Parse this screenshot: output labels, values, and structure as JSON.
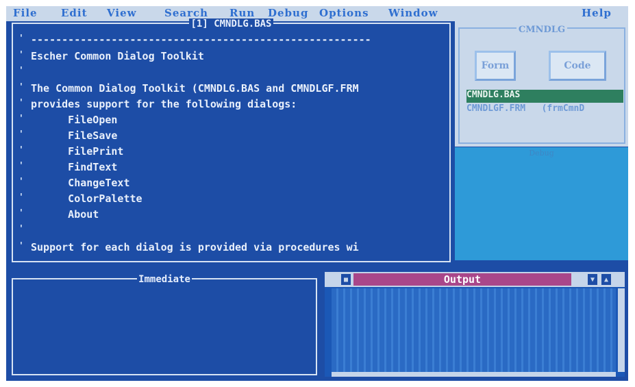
{
  "menu": {
    "items": [
      "File",
      "Edit",
      "View",
      "Search",
      "Run",
      "Debug",
      "Options",
      "Window"
    ],
    "help": "Help"
  },
  "editor": {
    "title": "[1] CMNDLG.BAS",
    "lines": [
      "-------------------------------------------------------",
      "Escher Common Dialog Toolkit",
      "",
      "The Common Dialog Toolkit (CMNDLG.BAS and CMNDLGF.FRM",
      "provides support for the following dialogs:",
      "      FileOpen",
      "      FileSave",
      "      FilePrint",
      "      FindText",
      "      ChangeText",
      "      ColorPalette",
      "      About",
      "",
      "Support for each dialog is provided via procedures wi"
    ]
  },
  "project": {
    "title": "CMNDLG",
    "form_button": "Form",
    "code_button": "Code",
    "files": [
      {
        "name": "CMNDLG.BAS",
        "selected": true
      },
      {
        "name": "CMNDLGF.FRM   (frmCmnD",
        "selected": false
      }
    ]
  },
  "debug": {
    "title": "Debug"
  },
  "immediate": {
    "title": "Immediate"
  },
  "output": {
    "title": "Output"
  }
}
